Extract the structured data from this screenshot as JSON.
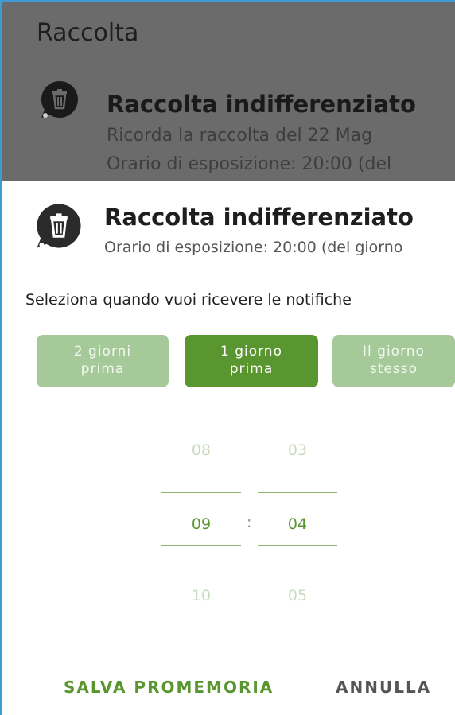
{
  "background": {
    "title": "Raccolta",
    "item": {
      "title": "Raccolta indifferenziato",
      "line1": "Ricorda la raccolta del 22 Mag",
      "line2": "Orario di esposizione: 20:00 (del"
    }
  },
  "dialog": {
    "title": "Raccolta indifferenziato",
    "subtitle": "Orario di esposizione: 20:00 (del giorno",
    "select_label": "Seleziona quando vuoi ricevere le notifiche",
    "choices": [
      {
        "line1": "2 giorni",
        "line2": "prima",
        "selected": false
      },
      {
        "line1": "1 giorno",
        "line2": "prima",
        "selected": true
      },
      {
        "line1": "Il giorno",
        "line2": "stesso",
        "selected": false
      }
    ],
    "time_picker": {
      "hours": {
        "prev": "08",
        "current": "09",
        "next": "10"
      },
      "minutes": {
        "prev": "03",
        "current": "04",
        "next": "05"
      },
      "separator": ":"
    },
    "buttons": {
      "save": "SALVA PROMEMORIA",
      "cancel": "ANNULLA"
    }
  },
  "icons": {
    "category": "trash-icon"
  },
  "colors": {
    "accent": "#5a962f",
    "accent_light": "#a6c99a",
    "scrim": "#6b6b6b",
    "frame": "#3f9ad6"
  }
}
